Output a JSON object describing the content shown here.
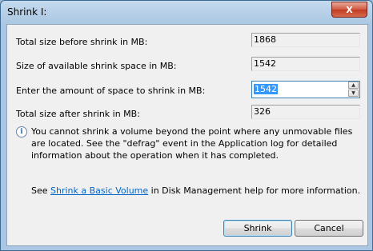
{
  "window": {
    "title": "Shrink I:",
    "close_label": "X"
  },
  "fields": {
    "total_before_label": "Total size before shrink in MB:",
    "total_before_value": "1868",
    "available_label": "Size of available shrink space in MB:",
    "available_value": "1542",
    "amount_label": "Enter the amount of space to shrink in MB:",
    "amount_value": "1542",
    "total_after_label": "Total size after shrink in MB:",
    "total_after_value": "326"
  },
  "info": {
    "icon": "info-icon",
    "text": "You cannot shrink a volume beyond the point where any unmovable files are located. See the \"defrag\" event in the Application log for detailed information about the operation when it has completed."
  },
  "help": {
    "prefix": "See ",
    "link_text": "Shrink a Basic Volume",
    "suffix": " in Disk Management help for more information."
  },
  "buttons": {
    "shrink": "Shrink",
    "cancel": "Cancel"
  },
  "colors": {
    "title_bar": "#aac6e2",
    "close_button": "#c13b21",
    "selection": "#3399ff",
    "link": "#0066cc"
  }
}
